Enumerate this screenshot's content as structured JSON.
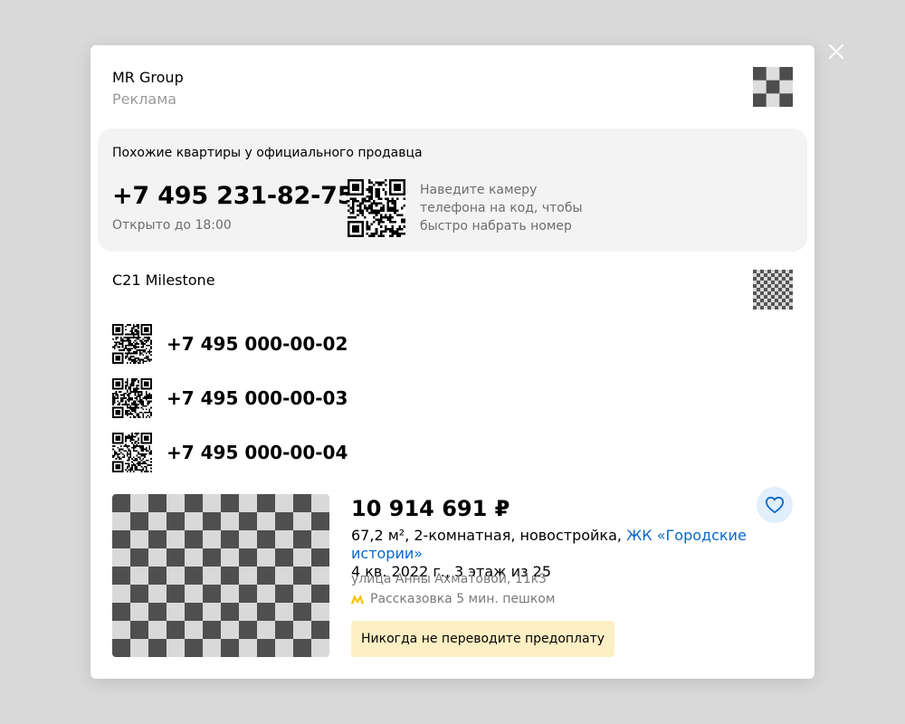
{
  "modal": {
    "advertiser": {
      "name": "MR Group",
      "ad_label": "Реклама"
    },
    "promo": {
      "title": "Похожие квартиры у официального продавца",
      "phone": "+7 495 231-82-75",
      "hours": "Открыто до 18:00",
      "hint_lines": [
        "Наведите камеру",
        "телефона на код, чтобы",
        "быстро набрать номер"
      ]
    },
    "agency": {
      "name": "C21 Milestone",
      "phones": [
        "+7 495 000-00-02",
        "+7 495 000-00-03",
        "+7 495 000-00-04"
      ]
    },
    "listing": {
      "price": "10 914 691 ₽",
      "details_prefix": "67,2 м², 2-комнатная, новостройка, ",
      "complex_link": "ЖК «Городские истории»",
      "completion_floor": "4 кв. 2022 г., 3 этаж из 25",
      "address": "улица Анны Ахматовой, 11к3",
      "metro": "Рассказовка 5 мин. пешком",
      "warning": "Никогда не переводите предоплату"
    }
  },
  "icons": {
    "close": "close-icon",
    "favorite": "heart-icon",
    "metro": "metro-icon"
  },
  "colors": {
    "link": "#0868c9",
    "metro": "#f5c400",
    "favorite_bg": "#e1eefb",
    "favorite_icon": "#0868c9",
    "warning_bg": "#fdefc4",
    "promo_bg": "#f3f3f3"
  }
}
